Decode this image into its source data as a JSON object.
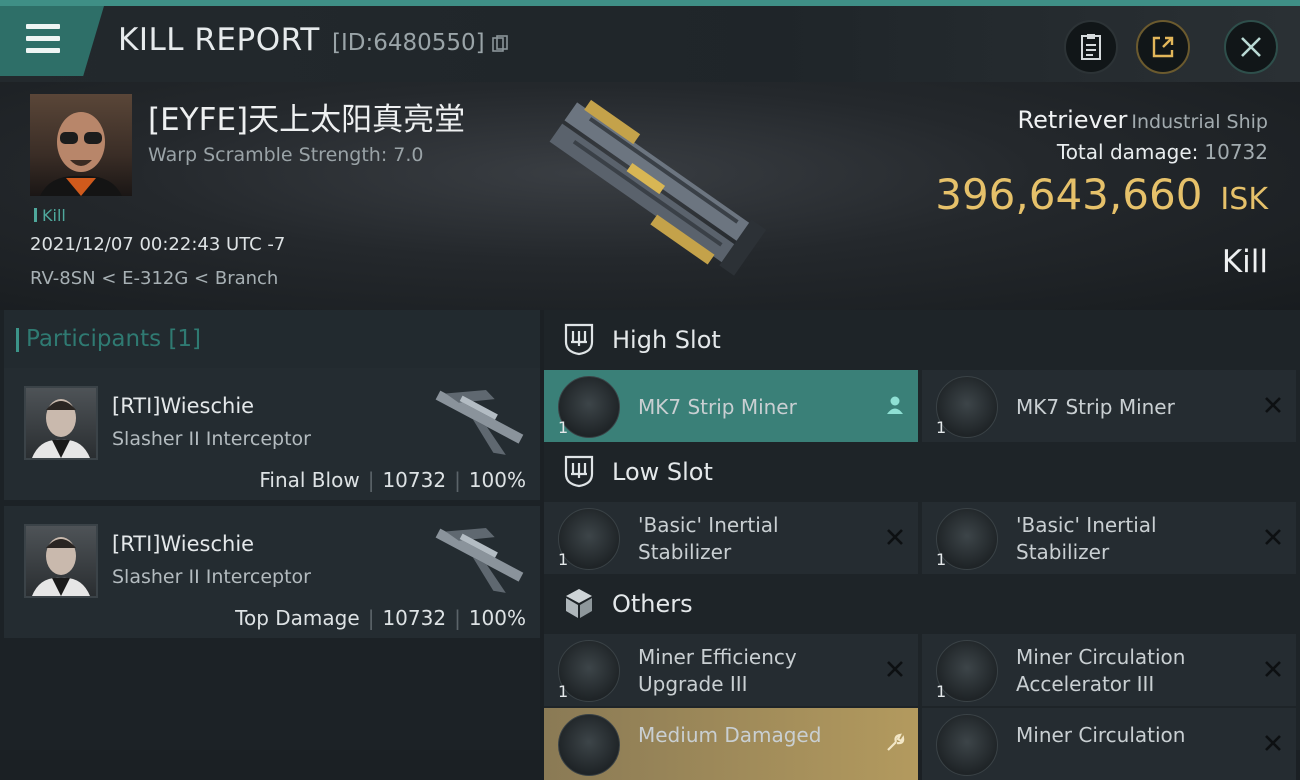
{
  "header": {
    "title": "KILL REPORT",
    "report_id": "[ID:6480550]",
    "buttons": {
      "clipboard": "clipboard-icon",
      "share": "share-icon",
      "close": "close-icon"
    }
  },
  "victim": {
    "name": "[EYFE]天上太阳真亮堂",
    "warp_scramble": "Warp Scramble Strength: 7.0",
    "kill_tag": "Kill",
    "timestamp": "2021/12/07 00:22:43 UTC -7",
    "location": "RV-8SN < E-312G < Branch",
    "ship_name": "Retriever",
    "ship_class": "Industrial Ship",
    "total_damage_label": "Total damage:",
    "total_damage": "10732",
    "isk_value": "396,643,660",
    "isk_unit": "ISK",
    "result": "Kill"
  },
  "participants": {
    "header": "Participants [1]",
    "items": [
      {
        "name": "[RTI]Wieschie",
        "ship": "Slasher II Interceptor",
        "role": "Final Blow",
        "damage": "10732",
        "percent": "100%"
      },
      {
        "name": "[RTI]Wieschie",
        "ship": "Slasher II Interceptor",
        "role": "Top Damage",
        "damage": "10732",
        "percent": "100%"
      }
    ]
  },
  "fittings": {
    "high_slot": {
      "label": "High Slot",
      "modules": [
        {
          "name": "MK7 Strip Miner",
          "qty": "1",
          "state": "user-icon"
        },
        {
          "name": "MK7 Strip Miner",
          "qty": "1",
          "state": "destroyed-x-icon"
        }
      ]
    },
    "low_slot": {
      "label": "Low Slot",
      "modules": [
        {
          "name": "'Basic' Inertial Stabilizer",
          "qty": "1",
          "state": "destroyed-x-icon"
        },
        {
          "name": "'Basic' Inertial Stabilizer",
          "qty": "1",
          "state": "destroyed-x-icon"
        }
      ]
    },
    "others": {
      "label": "Others",
      "modules": [
        {
          "name": "Miner Efficiency Upgrade III",
          "qty": "1",
          "state": "destroyed-x-icon"
        },
        {
          "name": "Miner Circulation Accelerator III",
          "qty": "1",
          "state": "destroyed-x-icon"
        },
        {
          "name": "Medium Damaged",
          "qty": "",
          "state": "wrench-icon"
        },
        {
          "name": "Miner Circulation",
          "qty": "",
          "state": "destroyed-x-icon"
        }
      ]
    }
  },
  "colors": {
    "accent": "#3a8078",
    "isk": "#e6c16a",
    "warning": "#b39a5e"
  }
}
